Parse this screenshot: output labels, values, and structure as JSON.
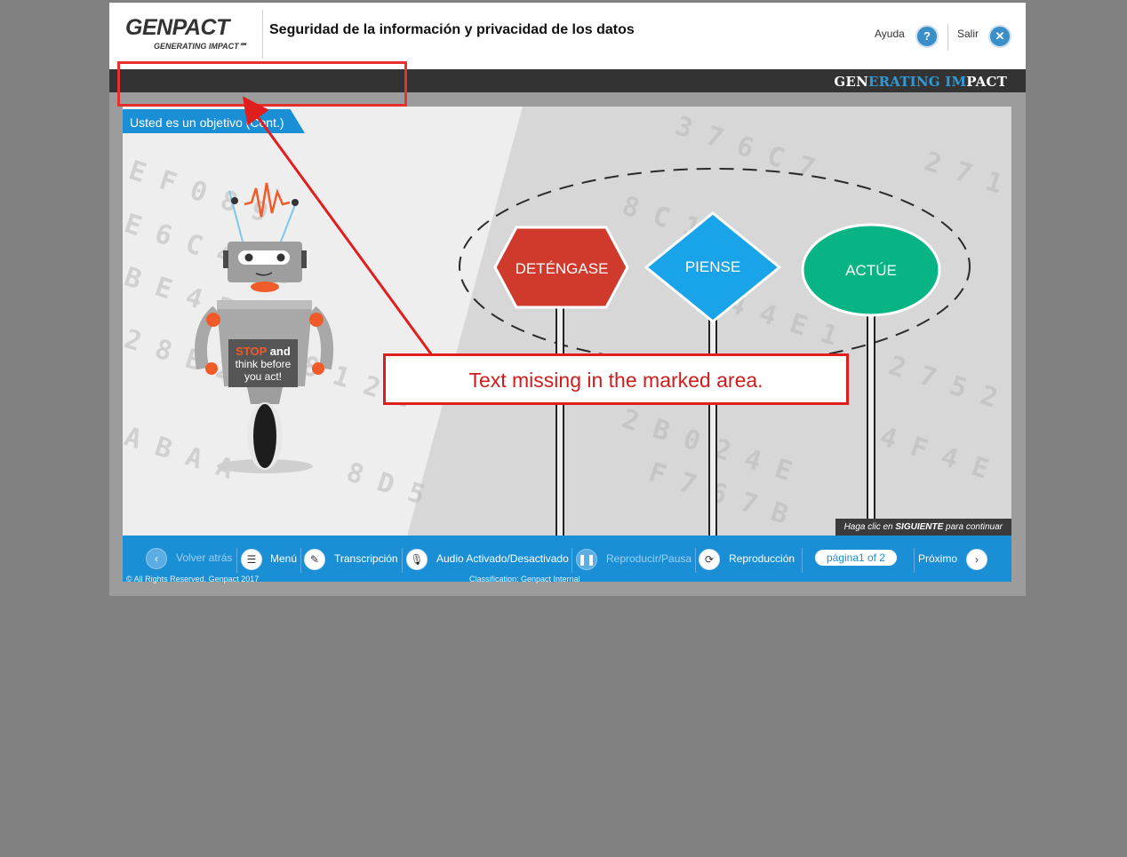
{
  "header": {
    "logo": "GENPACT",
    "logo_tagline": "GENERATING IMPACT℠",
    "course_title": "Seguridad de la información y privacidad de los datos",
    "help_label": "Ayuda",
    "help_icon": "question-icon",
    "exit_label": "Salir",
    "exit_icon": "close-icon"
  },
  "brand_bar": {
    "part1": "GEN",
    "part2": "ERATING ",
    "part3": "IM",
    "part4": "PACT"
  },
  "slide": {
    "title": "Usted es un objetivo (Cont.)",
    "robot_sign_stop": "STOP",
    "robot_sign_rest1": " and",
    "robot_sign_line2": "think before",
    "robot_sign_line3": "you act!",
    "signs": [
      "DETÉNGASE",
      "PIENSE",
      "ACTÚE"
    ],
    "sign_colors": [
      "#d03a2c",
      "#19a3e8",
      "#08b483"
    ],
    "continue_prefix": "Haga clic en ",
    "continue_bold": "SIGUIENTE",
    "continue_suffix": " para continuar"
  },
  "nav": {
    "back": "Volver atrás",
    "menu": "Menú",
    "transcript": "Transcripción",
    "audio": "Audio Activado/Desactivado",
    "play_pause": "Reproducir/Pausa",
    "replay": "Reproducción",
    "page_indicator": "página1 of 2",
    "next": "Próximo",
    "copyright": "© All Rights Reserved. Genpact 2017",
    "classification": "Classification: Genpact Internal"
  },
  "annotation": {
    "text": "Text missing in the marked area.",
    "color": "#e01e1e"
  }
}
